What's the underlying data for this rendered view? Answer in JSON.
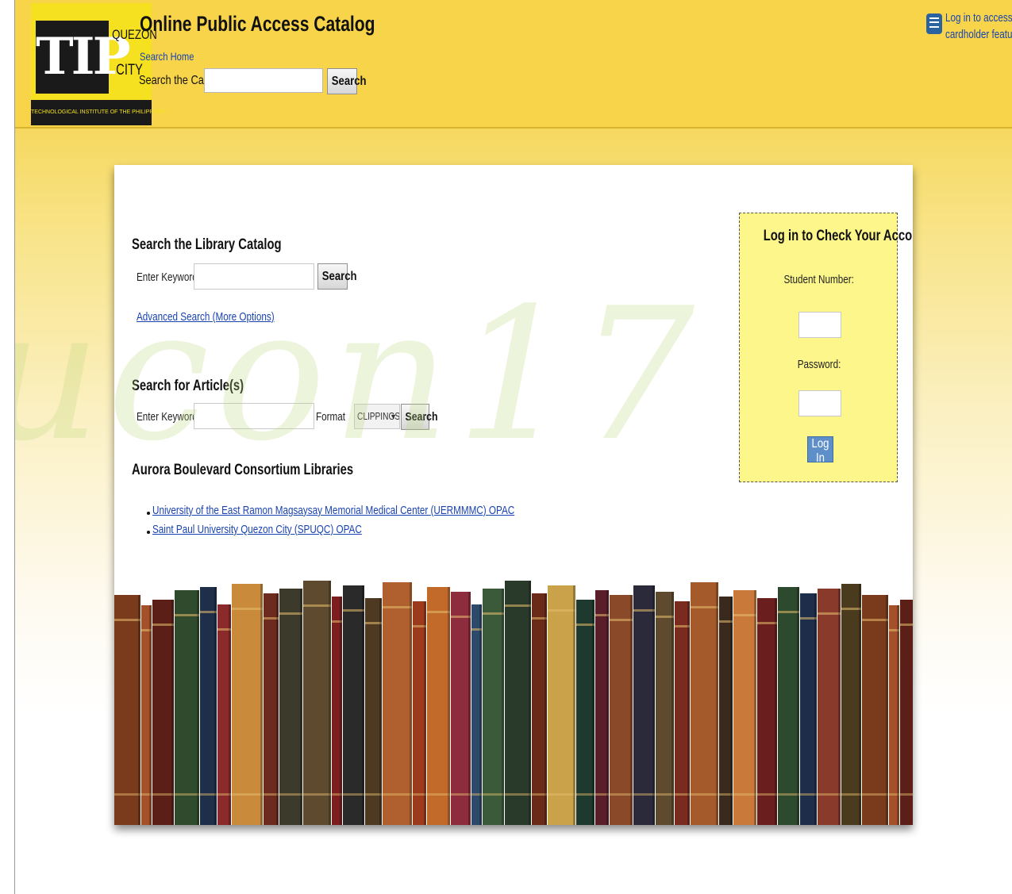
{
  "logo": {
    "mark": "TIP",
    "city_line1": "QUEZON",
    "city_line2": "CITY",
    "tagline": "TECHNOLOGICAL INSTITUTE OF THE PHILIPPINES"
  },
  "header": {
    "title": "Online Public Access Catalog",
    "search_home_link": "Search Home",
    "search_label": "Search the Catalog",
    "search_value": "",
    "search_button": "Search",
    "login_link": "Log in to access cardholder features",
    "login_link_line1": "Log in to access",
    "login_link_line2": "cardholder features"
  },
  "catalog_search": {
    "heading": "Search the Library Catalog",
    "keyword_label": "Enter Keyword(s):",
    "keyword_value": "",
    "search_button": "Search",
    "advanced_link": "Advanced Search (More Options)"
  },
  "article_search": {
    "heading": "Search for Article(s)",
    "keyword_label": "Enter Keyword(s):",
    "keyword_value": "",
    "format_label": "Format",
    "format_selected": "CLIPPINGS",
    "search_button": "Search"
  },
  "consortium": {
    "heading": "Aurora Boulevard Consortium Libraries",
    "links": [
      "University of the East Ramon Magsaysay Memorial Medical Center (UERMMMC) OPAC",
      "Saint Paul University Quezon City (SPUQC) OPAC"
    ]
  },
  "login_box": {
    "title": "Log in to Check Your Account",
    "student_number_label": "Student Number:",
    "password_label": "Password:",
    "login_button": "Log In"
  },
  "watermark": "ucon17",
  "bookshelf": {
    "books": [
      {
        "color": "#7a3b1c"
      },
      {
        "color": "#a4502a"
      },
      {
        "color": "#5b1f18"
      },
      {
        "color": "#2f4a2c"
      },
      {
        "color": "#1f2f4a"
      },
      {
        "color": "#8a2a2a"
      },
      {
        "color": "#c98a3c"
      },
      {
        "color": "#6d2a1e"
      },
      {
        "color": "#3c3a2a"
      },
      {
        "color": "#5e4a2e"
      },
      {
        "color": "#7c1e1e"
      },
      {
        "color": "#2a2a2a"
      },
      {
        "color": "#4e3a22"
      },
      {
        "color": "#b0602e"
      },
      {
        "color": "#9c3a1c"
      },
      {
        "color": "#c26a2a"
      },
      {
        "color": "#8c2c3c"
      },
      {
        "color": "#2e4a6a"
      },
      {
        "color": "#3a5a3a"
      },
      {
        "color": "#2a3a2a"
      },
      {
        "color": "#6a2a18"
      },
      {
        "color": "#c9a24a"
      },
      {
        "color": "#1e3a2e"
      },
      {
        "color": "#5a1e2a"
      },
      {
        "color": "#8a4a2a"
      },
      {
        "color": "#2a2a3a"
      },
      {
        "color": "#5e4a2e"
      },
      {
        "color": "#7a2a1e"
      },
      {
        "color": "#a45a2a"
      },
      {
        "color": "#3a2a1e"
      },
      {
        "color": "#c97a3a"
      },
      {
        "color": "#6a1e1e"
      },
      {
        "color": "#2e4a2e"
      },
      {
        "color": "#1e2e4a"
      },
      {
        "color": "#8a3a2a"
      },
      {
        "color": "#4a3a1e"
      }
    ]
  }
}
